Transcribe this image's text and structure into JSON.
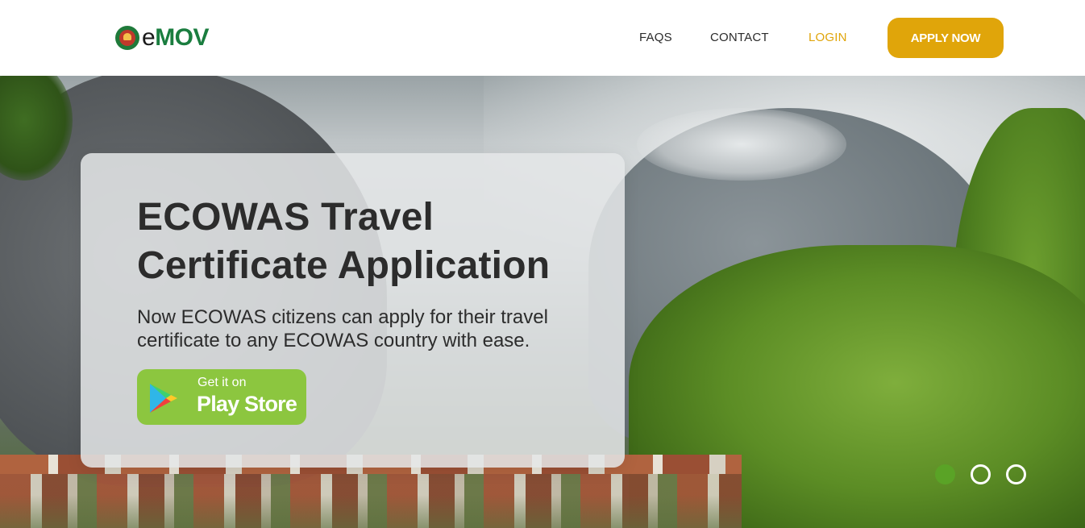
{
  "header": {
    "logo_text_prefix": "e",
    "logo_text_main": "MOV",
    "nav": {
      "faqs": "FAQS",
      "contact": "CONTACT",
      "login": "LOGIN"
    },
    "apply_button": "APPLY NOW"
  },
  "hero": {
    "title": "ECOWAS Travel Certificate Application",
    "subtitle": "Now ECOWAS citizens can apply for their travel certificate to any ECOWAS country with ease.",
    "play_store": {
      "small_label": "Get it on",
      "big_label": "Play Store"
    },
    "carousel": {
      "total_slides": 3,
      "active_slide": 1
    }
  },
  "colors": {
    "accent_gold": "#e0a50a",
    "brand_green": "#1a7d3f",
    "play_green": "#8cc63f",
    "active_dot": "#5aa326"
  }
}
